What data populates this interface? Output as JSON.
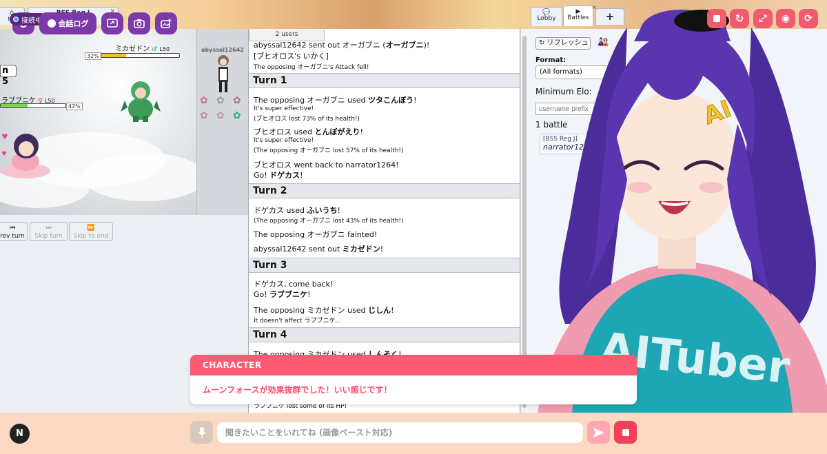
{
  "site_tabs": {
    "home": "Ho",
    "room": "BSS Reg J",
    "lobby": "Lobby",
    "battles": "Battles",
    "add": "+"
  },
  "overlay": {
    "connection_status": "接続中",
    "chat_log_label": "会話ログ"
  },
  "battle": {
    "turn_label": "n 5",
    "foe": {
      "name": "ミカゼドン",
      "level": "L50",
      "hp_percent": 32,
      "hp_label": "32%",
      "gender_icon": "male-icon"
    },
    "ally": {
      "name": "ラブブニケ",
      "level": "L50",
      "hp_percent": 42,
      "hp_label": "42%",
      "gender_icon": "female-icon"
    },
    "trainer_name": "abyssal12642",
    "hp_colors": {
      "foe": "#f4c21a",
      "ally": "#7ad84a"
    }
  },
  "controls": {
    "prev_turn": "rev turn",
    "skip_turn": "Skip turn",
    "skip_to_end": "Skip to end"
  },
  "log": {
    "users": "2 users",
    "intro": [
      {
        "text": "abyssal12642 sent out オーガブニ (",
        "bold": "オーガブニ",
        "after": ")!"
      },
      {
        "text": "[ブヒオロス's いかく]"
      },
      {
        "text": "The opposing オーガブニ's Attack fell!"
      }
    ],
    "turn1": {
      "title": "Turn 1",
      "lines": [
        {
          "pre": "The opposing オーガブニ used ",
          "bold": "ツタこんぼう",
          "post": "!"
        },
        {
          "pre": "It's super effective!",
          "small": true
        },
        {
          "pre": "(ブヒオロス lost 73% of its health!)",
          "small": true
        },
        {
          "pre": "ブヒオロス used ",
          "bold": "とんぼがえり",
          "post": "!"
        },
        {
          "pre": "It's super effective!",
          "small": true
        },
        {
          "pre": "(The opposing オーガブニ lost 57% of its health!)",
          "small": true
        },
        {
          "pre": "ブヒオロス went back to narrator1264!"
        },
        {
          "pre": "Go! ",
          "bold": "ドゲカス",
          "post": "!"
        }
      ]
    },
    "turn2": {
      "title": "Turn 2",
      "lines": [
        {
          "pre": "ドゲカス used ",
          "bold": "ふいうち",
          "post": "!"
        },
        {
          "pre": "(The opposing オーガブニ lost 43% of its health!)",
          "small": true
        },
        {
          "pre": "The opposing オーガブニ fainted!"
        },
        {
          "pre": "abyssal12642 sent out ",
          "bold": "ミカゼドン",
          "post": "!"
        }
      ]
    },
    "turn3": {
      "title": "Turn 3",
      "lines": [
        {
          "pre": "ドゲカス, come back!"
        },
        {
          "pre": "Go! ",
          "bold": "ラブブニケ",
          "post": "!"
        },
        {
          "pre": "The opposing ミカゼドン used ",
          "bold": "じしん",
          "post": "!"
        },
        {
          "pre": "It doesn't affect ラブブニケ...",
          "small": true
        }
      ]
    },
    "turn4": {
      "title": "Turn 4",
      "lines": [
        {
          "pre": "The opposing ミカゼドン used ",
          "bold": "しんそく",
          "post": "!"
        }
      ]
    },
    "trailing": "ラブブニケ lost some of its HP!"
  },
  "right_panel": {
    "refresh": "リフレッシュ",
    "format_label": "Format:",
    "format_value": "(All formats)",
    "min_elo_label": "Minimum Elo:",
    "username_placeholder": "username prefix",
    "battle_count": "1 battle",
    "battle_format": "[BSS Reg J]",
    "battle_player": "narrator1264"
  },
  "character": {
    "header": "CHARACTER",
    "message": "ムーンフォースが効果抜群でした！いい感じです！",
    "shirt_text": "AITuber",
    "hairclip_text": "AI"
  },
  "bottom": {
    "logo_letter": "N",
    "input_placeholder": "聞きたいことをいれてね (画像ペースト対応)"
  },
  "colors": {
    "accent_purple": "#7b3aa8",
    "accent_red": "#f25a6e",
    "card_header": "#ff5a73",
    "bottom_bar": "#fbd9c2"
  }
}
